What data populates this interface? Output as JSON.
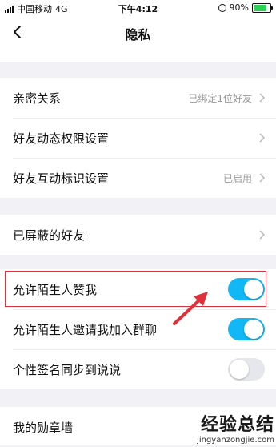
{
  "status_bar": {
    "carrier": "中国移动",
    "network": "4G",
    "time": "下午4:12",
    "battery": "90%",
    "battery_level": 0.9
  },
  "nav": {
    "title": "隐私"
  },
  "groups": {
    "relations": [
      {
        "label": "亲密关系",
        "value": "已绑定1位好友"
      },
      {
        "label": "好友动态权限设置",
        "value": ""
      },
      {
        "label": "好友互动标识设置",
        "value": "已启用"
      }
    ],
    "blocked": [
      {
        "label": "已屏蔽的好友",
        "value": ""
      }
    ],
    "stranger": [
      {
        "label": "允许陌生人赞我",
        "toggle": true
      },
      {
        "label": "允许陌生人邀请我加入群聊",
        "toggle": true
      },
      {
        "label": "个性签名同步到说说",
        "toggle": false
      }
    ],
    "medal": [
      {
        "label": "我的勋章墙"
      }
    ]
  },
  "colors": {
    "accent": "#12b7f5",
    "highlight": "#e0303a"
  },
  "watermark": {
    "text": "经验总结",
    "url": "jingyanzongjie.com"
  }
}
